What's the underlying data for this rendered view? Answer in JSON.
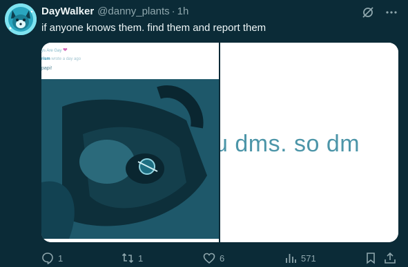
{
  "tweet": {
    "display_name": "DayWalker",
    "handle": "@danny_plants",
    "separator": "·",
    "time": "1h",
    "text": "if anyone knows them. find them and report them"
  },
  "media_left": {
    "header": "ys Are Gay",
    "author": "rism",
    "author_meta": "wrote a day ago",
    "message": "papi!"
  },
  "media_right": {
    "text": "u dms. so dm"
  },
  "actions": {
    "replies": "1",
    "retweets": "1",
    "likes": "6",
    "views": "571"
  },
  "icons": {
    "header": [
      "grok-icon",
      "more-icon"
    ],
    "actions": [
      "reply-icon",
      "retweet-icon",
      "like-icon",
      "views-icon",
      "bookmark-icon",
      "share-icon"
    ]
  },
  "colors": {
    "background": "#0b2b37",
    "text": "#eef6f7",
    "muted": "#8fa7ad",
    "heart": "#d46ab9"
  }
}
